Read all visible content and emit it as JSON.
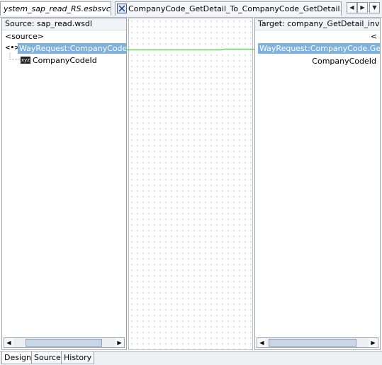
{
  "tabs": {
    "tab1_label": "ystem_sap_read_RS.esbsvc",
    "tab2_label": "CompanyCode_GetDetail_To_CompanyCode_GetDetail.xsl",
    "nav_left": "◀",
    "nav_right": "▶",
    "nav_menu": "▼"
  },
  "left_pane": {
    "title": "Source: sap_read.wsdl",
    "root_label": "<source>",
    "node_icon": "<•>",
    "node_label": "WayRequest:CompanyCode.Ge",
    "child_icon": "xyz",
    "child_label": "CompanyCodeId"
  },
  "right_pane": {
    "title": "Target: company_GetDetail_invoke",
    "root_label": "<",
    "node_label": "WayRequest:CompanyCode.GetDe",
    "child_label": "CompanyCodeId"
  },
  "scrollbar": {
    "left_arrow": "◀",
    "right_arrow": "▶"
  },
  "bottom_tabs": [
    "Design",
    "Source",
    "History"
  ],
  "colors": {
    "selection": "#7fb1de",
    "map_line": "#5dd55d"
  }
}
